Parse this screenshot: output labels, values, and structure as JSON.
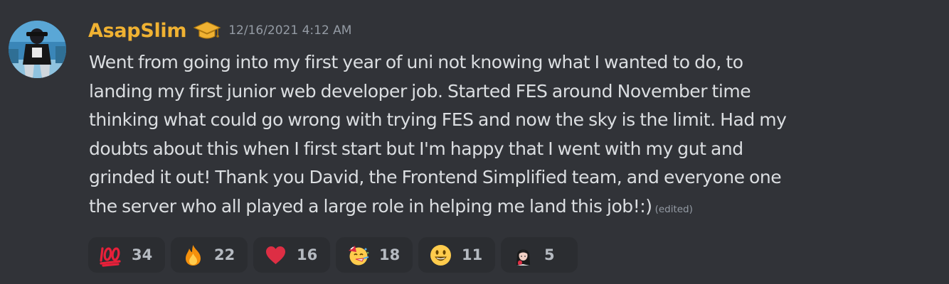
{
  "message": {
    "author": "AsapSlim",
    "author_color": "#f0b232",
    "role_icon": "graduation-cap-icon",
    "timestamp": "12/16/2021 4:12 AM",
    "lines": [
      "Went from going into my first year of uni not knowing what I wanted to do, to",
      "landing my first junior web developer job. Started FES around November time",
      "thinking what could go wrong with trying FES and now the sky is the limit. Had my",
      "doubts about this when I first start but I'm happy that I went with my gut and",
      "grinded it out! Thank you David, the Frontend Simplified team, and everyone one",
      "the server who all played a large role in helping me land this job!:)"
    ],
    "edited_label": "(edited)"
  },
  "reactions": [
    {
      "emoji": "hundred-points-icon",
      "count": "34"
    },
    {
      "emoji": "fire-icon",
      "count": "22"
    },
    {
      "emoji": "red-heart-icon",
      "count": "16"
    },
    {
      "emoji": "party-face-icon",
      "count": "18"
    },
    {
      "emoji": "smiley-face-icon",
      "count": "11"
    },
    {
      "emoji": "custom-girl-emoji-icon",
      "count": "5"
    }
  ],
  "colors": {
    "background": "#313338",
    "text": "#dbdee1",
    "muted": "#949ba4",
    "reaction_bg": "#2b2d31"
  }
}
